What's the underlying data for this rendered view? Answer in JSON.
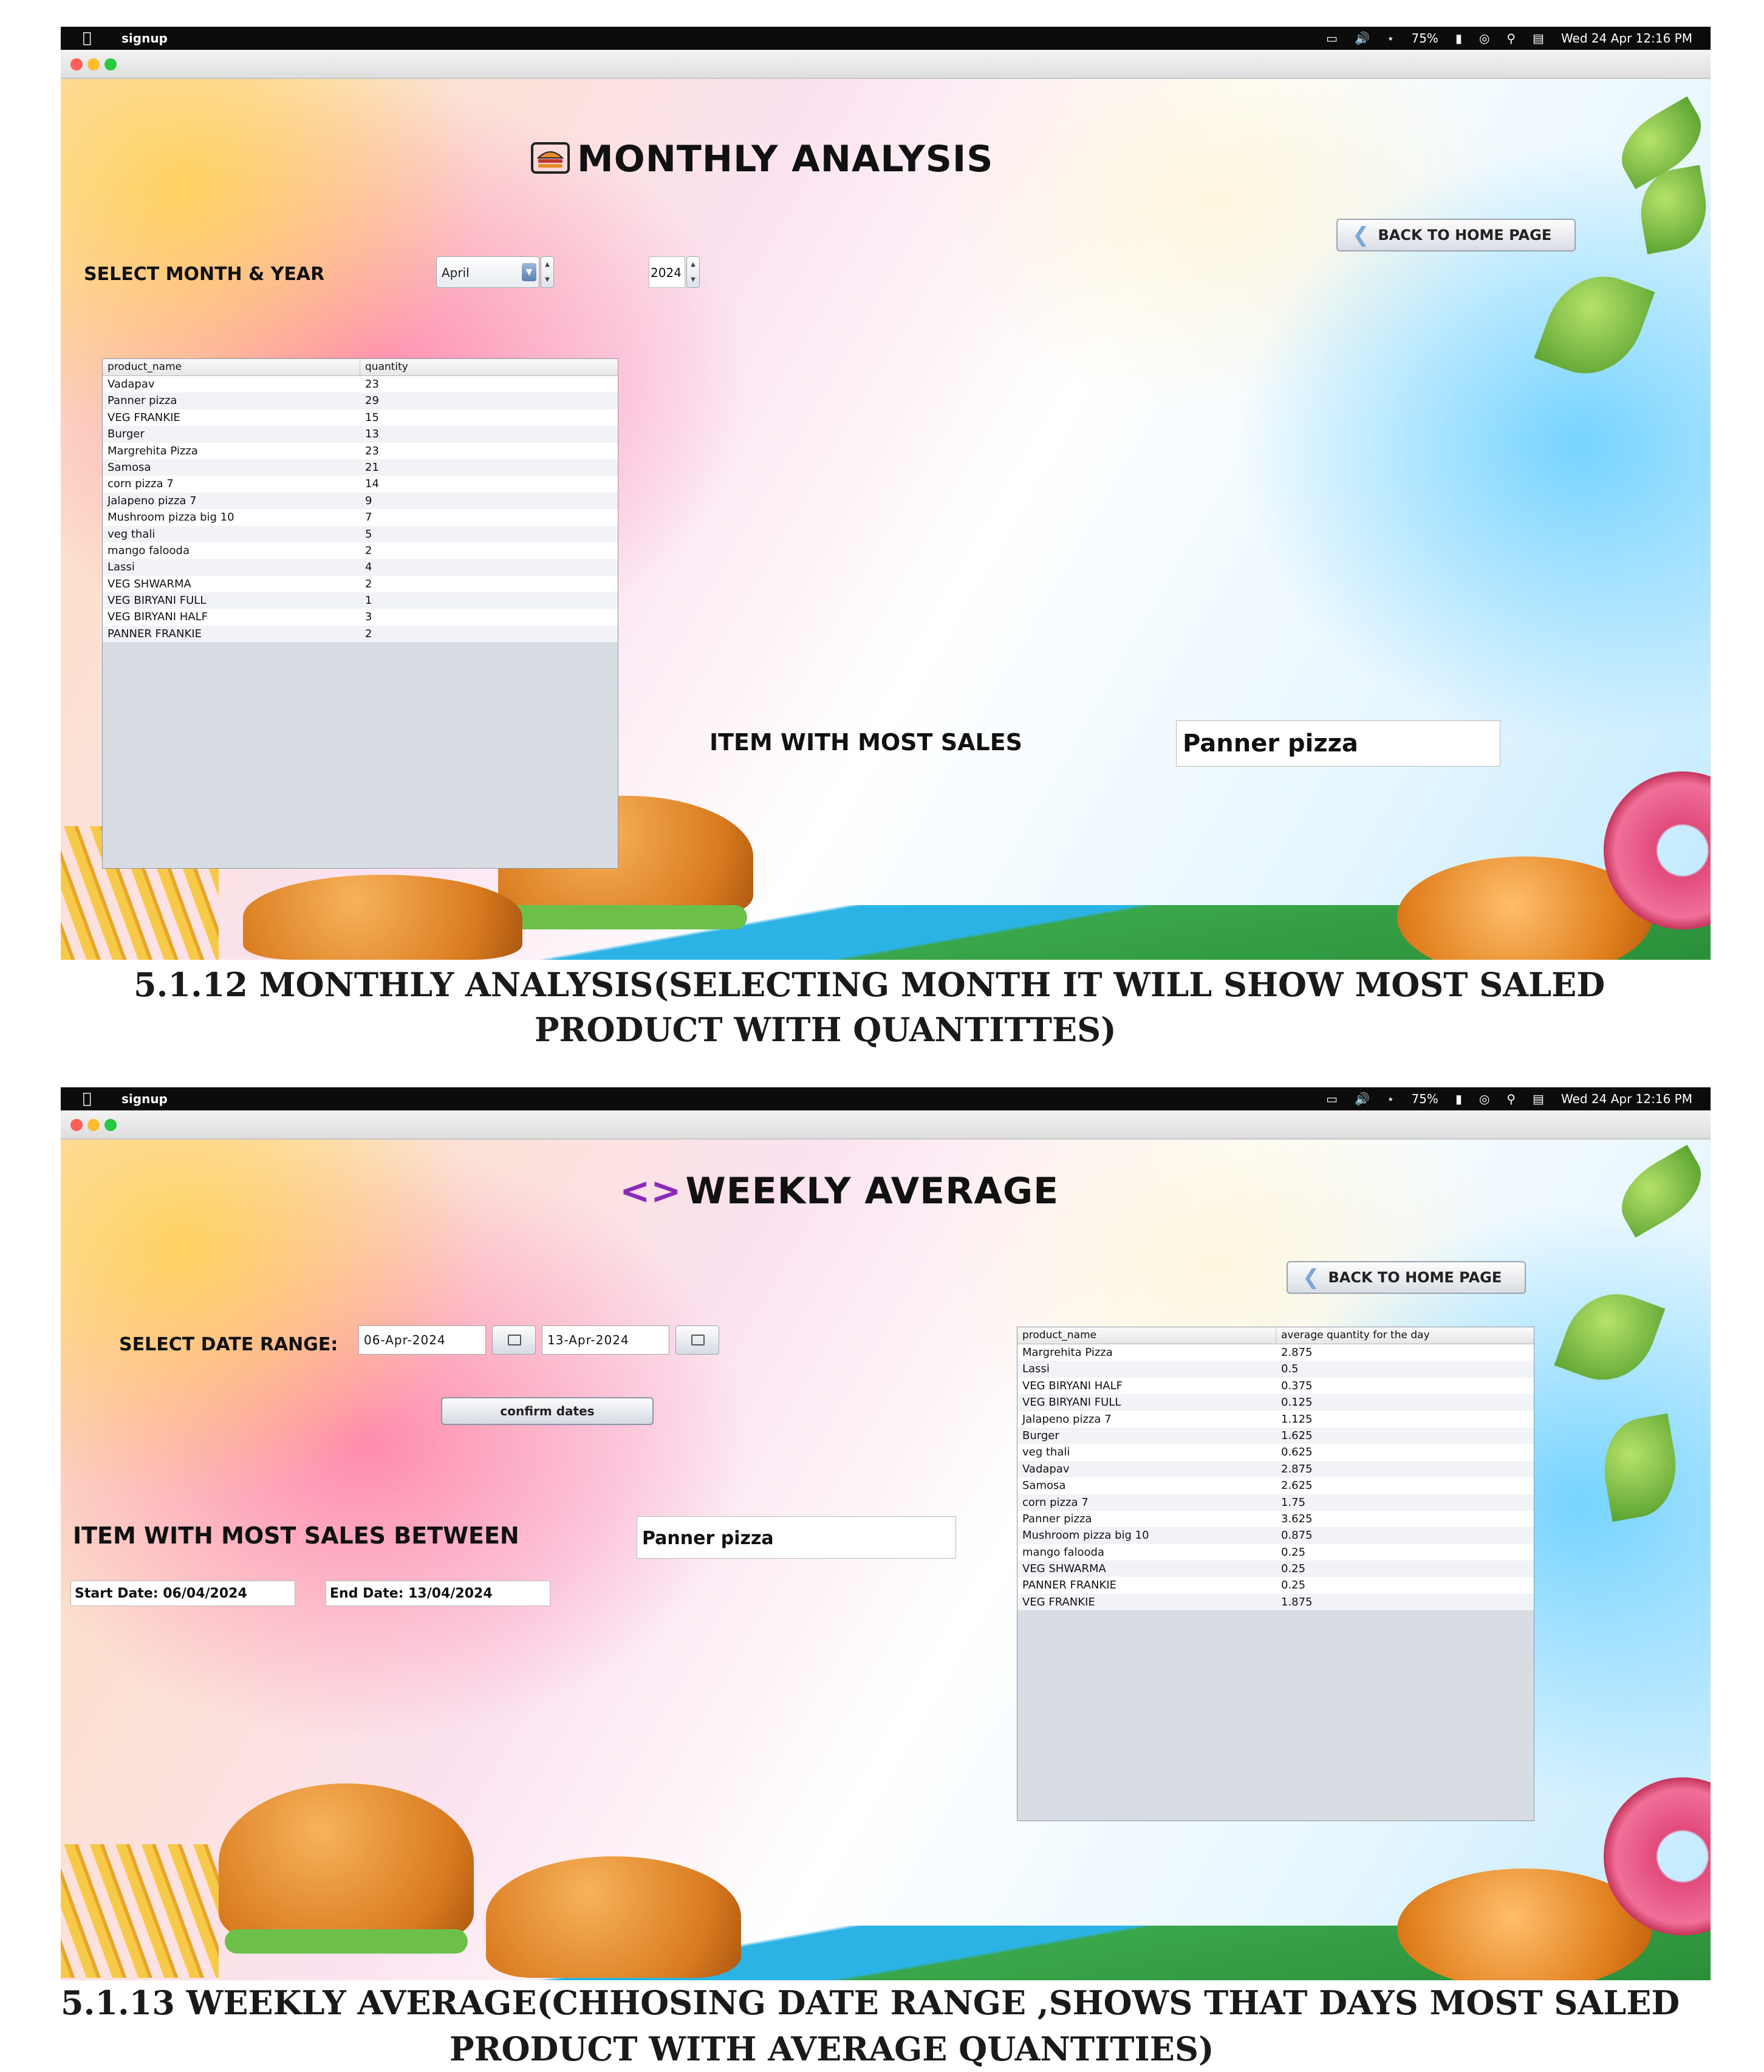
{
  "menubar": {
    "app_name": "signup",
    "status_battery": "75%",
    "status_datetime": "Wed 24 Apr  12:16 PM"
  },
  "monthly": {
    "title": "MONTHLY ANALYSIS",
    "back_label": "BACK TO HOME PAGE",
    "select_label": "SELECT MONTH & YEAR",
    "month_value": "April",
    "year_value": "2024",
    "table": {
      "columns": [
        "product_name",
        "quantity"
      ],
      "rows": [
        [
          "Vadapav",
          "23"
        ],
        [
          "Panner pizza",
          "29"
        ],
        [
          "VEG FRANKIE",
          "15"
        ],
        [
          "Burger",
          "13"
        ],
        [
          "Margrehita Pizza",
          "23"
        ],
        [
          "Samosa",
          "21"
        ],
        [
          "corn pizza 7",
          "14"
        ],
        [
          "Jalapeno pizza 7",
          "9"
        ],
        [
          "Mushroom pizza big 10",
          "7"
        ],
        [
          "veg thali",
          "5"
        ],
        [
          "mango falooda",
          "2"
        ],
        [
          "Lassi",
          "4"
        ],
        [
          "VEG SHWARMA",
          "2"
        ],
        [
          "VEG BIRYANI FULL",
          "1"
        ],
        [
          "VEG BIRYANI HALF",
          "3"
        ],
        [
          "PANNER FRANKIE",
          "2"
        ]
      ]
    },
    "most_sales_label": "ITEM WITH MOST SALES",
    "most_sales_value": "Panner pizza"
  },
  "caption1": {
    "line1": "5.1.12 MONTHLY ANALYSIS(SELECTING MONTH IT WILL SHOW MOST SALED",
    "line2": "PRODUCT WITH QUANTITTES)"
  },
  "weekly": {
    "title_icon": "<>",
    "title": "WEEKLY AVERAGE",
    "back_label": "BACK TO HOME PAGE",
    "date_range_label": "SELECT DATE RANGE:",
    "start_date": "06-Apr-2024",
    "end_date": "13-Apr-2024",
    "confirm_label": "confirm dates",
    "most_sales_label": "ITEM WITH MOST SALES BETWEEN",
    "most_sales_value": "Panner pizza",
    "start_date_display": "Start Date: 06/04/2024",
    "end_date_display": "End Date: 13/04/2024",
    "table": {
      "columns": [
        "product_name",
        "average quantity for the day"
      ],
      "rows": [
        [
          "Margrehita Pizza",
          "2.875"
        ],
        [
          "Lassi",
          "0.5"
        ],
        [
          "VEG BIRYANI HALF",
          "0.375"
        ],
        [
          "VEG BIRYANI FULL",
          "0.125"
        ],
        [
          "Jalapeno pizza 7",
          "1.125"
        ],
        [
          "Burger",
          "1.625"
        ],
        [
          "veg thali",
          "0.625"
        ],
        [
          "Vadapav",
          "2.875"
        ],
        [
          "Samosa",
          "2.625"
        ],
        [
          "corn pizza 7",
          "1.75"
        ],
        [
          "Panner pizza",
          "3.625"
        ],
        [
          "Mushroom pizza big 10",
          "0.875"
        ],
        [
          "mango falooda",
          "0.25"
        ],
        [
          "VEG SHWARMA",
          "0.25"
        ],
        [
          "PANNER FRANKIE",
          "0.25"
        ],
        [
          "VEG FRANKIE",
          "1.875"
        ]
      ]
    }
  },
  "caption2": {
    "line1": "5.1.13 WEEKLY AVERAGE(CHHOSING DATE RANGE ,SHOWS THAT DAYS MOST SALED",
    "line2": "PRODUCT WITH AVERAGE QUANTITIES)"
  },
  "colors": {
    "menubar": "#0c0c0c",
    "title_icon_purple": "#8a2bb8",
    "back_chevron": "#7aa6d9",
    "table_empty": "#d8dce3"
  },
  "icons": [
    "apple-icon",
    "display-icon",
    "volume-icon",
    "bluetooth-icon",
    "battery-icon",
    "wifi-icon",
    "search-icon",
    "control-center-icon",
    "food-icon",
    "back-chevron-icon",
    "calendar-icon"
  ]
}
